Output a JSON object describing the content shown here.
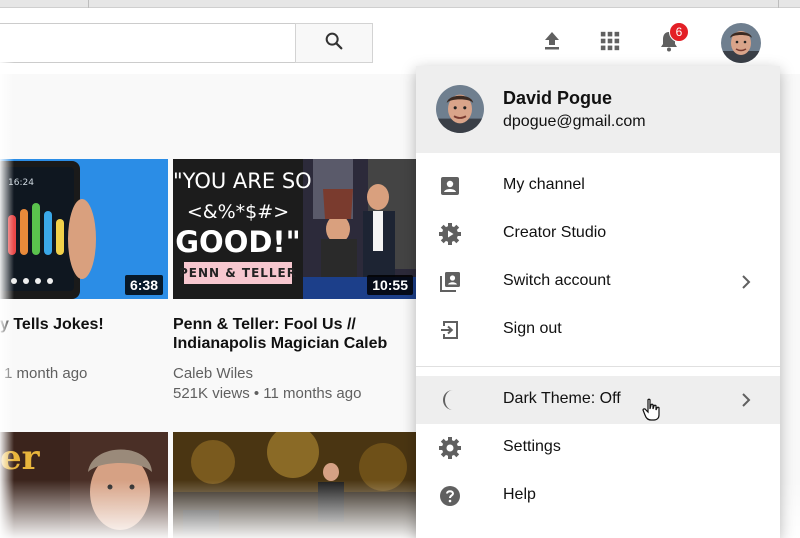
{
  "header": {
    "search": {
      "placeholder": "",
      "value": ""
    },
    "icons": [
      "search-icon",
      "upload-icon",
      "apps-icon",
      "bell-icon"
    ],
    "notification_count": "6"
  },
  "videos": [
    {
      "title": "y Tells Jokes!",
      "meta": "1 month ago",
      "duration": "6:38"
    },
    {
      "title_line1": "Penn & Teller: Fool Us //",
      "title_line2": "Indianapolis Magician Caleb",
      "channel": "Caleb Wiles",
      "views": "521K views • 11 months ago",
      "duration": "10:55",
      "thumb_text": {
        "line1": "\"YOU ARE SO",
        "line2": "<&%*$#>",
        "line3": "GOOD!\"",
        "tag": "PENN & TELLER"
      }
    },
    {
      "thumb_text": "er"
    }
  ],
  "menu": {
    "user": {
      "name": "David Pogue",
      "email": "dpogue@gmail.com"
    },
    "items": [
      {
        "label": "My channel",
        "icon": "person-box-icon"
      },
      {
        "label": "Creator Studio",
        "icon": "gear-play-icon"
      },
      {
        "label": "Switch account",
        "icon": "switch-account-icon",
        "has_chevron": true
      },
      {
        "label": "Sign out",
        "icon": "sign-out-icon"
      },
      {
        "label": "Dark Theme: Off",
        "icon": "moon-icon",
        "has_chevron": true,
        "highlighted": true
      },
      {
        "label": "Settings",
        "icon": "gear-icon"
      },
      {
        "label": "Help",
        "icon": "help-icon"
      }
    ]
  },
  "colors": {
    "badge": "#e31f26",
    "icon_gray": "#606060",
    "menu_header_bg": "#eeeeee",
    "tag_pink": "#f7c7cf",
    "thumb1_blue": "#2b8de6"
  }
}
